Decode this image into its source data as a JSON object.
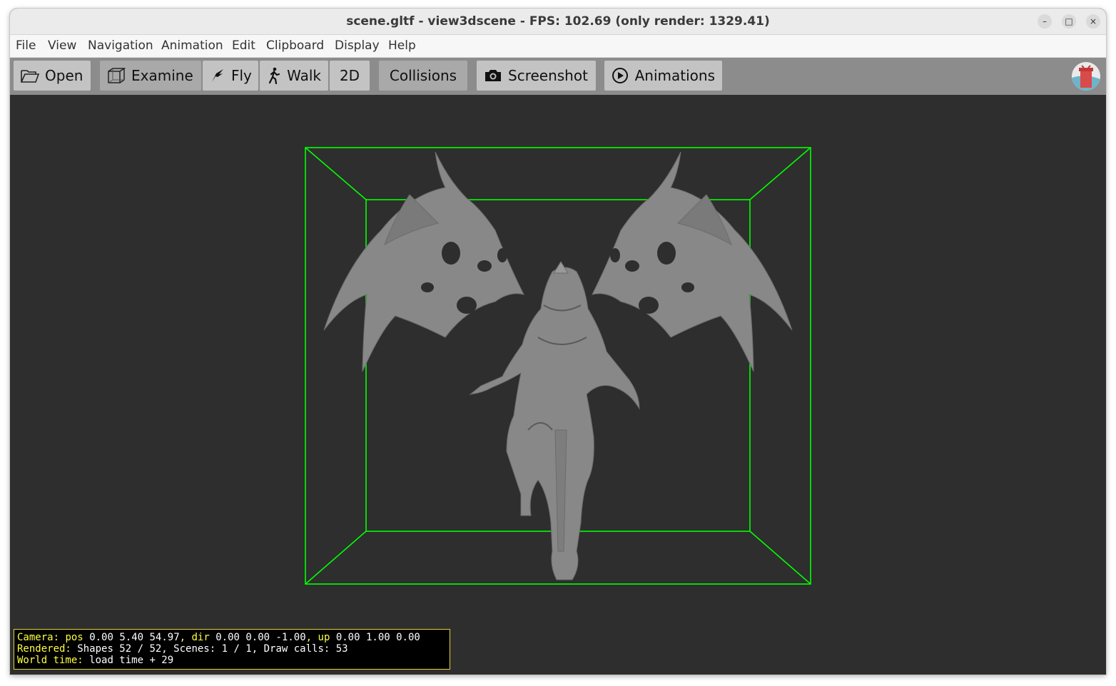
{
  "window": {
    "title": "scene.gltf - view3dscene - FPS: 102.69 (only render: 1329.41)",
    "minimize_glyph": "–",
    "maximize_glyph": "□",
    "close_glyph": "×"
  },
  "menu": {
    "items": [
      "File",
      "View",
      "Navigation",
      "Animation",
      "Edit",
      "Clipboard",
      "Display",
      "Help"
    ]
  },
  "toolbar": {
    "open": "Open",
    "examine": "Examine",
    "fly": "Fly",
    "walk": "Walk",
    "two_d": "2D",
    "collisions": "Collisions",
    "screenshot": "Screenshot",
    "animations": "Animations",
    "icons": [
      "folder-icon",
      "cube-icon",
      "bird-icon",
      "walk-icon",
      "camera-icon",
      "play-icon"
    ]
  },
  "viewport": {
    "bbox_color": "#00ff00",
    "model_color": "#8a8a8a",
    "background": "#2e2e2e"
  },
  "hud": {
    "camera_label": "Camera:",
    "pos_label": "pos",
    "pos_value": "0.00 5.40 54.97",
    "dir_label": "dir",
    "dir_value": "0.00 0.00 -1.00",
    "up_label": "up",
    "up_value": "0.00 1.00 0.00",
    "rendered_label": "Rendered:",
    "rendered_value": "Shapes 52 / 52, Scenes: 1 / 1, Draw calls: 53",
    "world_label": "World time:",
    "world_value": "load time + 29",
    "label_color": "#ffff40",
    "border_color": "#e3d33a"
  }
}
